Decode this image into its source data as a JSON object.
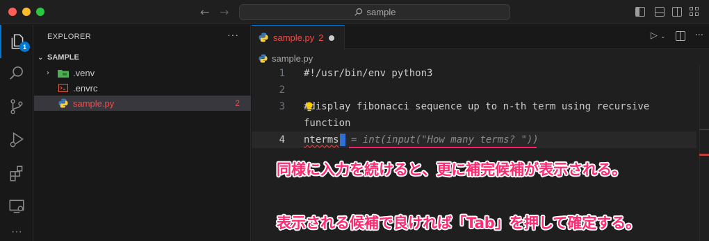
{
  "window": {
    "search_text": "sample"
  },
  "activity_bar": {
    "explorer_badge": "1"
  },
  "sidebar": {
    "title": "EXPLORER",
    "more": "···",
    "section": "SAMPLE",
    "items": [
      {
        "name": ".venv",
        "type": "folder"
      },
      {
        "name": ".envrc",
        "type": "file"
      },
      {
        "name": "sample.py",
        "type": "python",
        "errors": "2"
      }
    ]
  },
  "editor": {
    "tab": {
      "name": "sample.py",
      "count": "2"
    },
    "breadcrumb": "sample.py",
    "lines": [
      {
        "number": "1",
        "text": "#!/usr/bin/env python3"
      },
      {
        "number": "2",
        "text": ""
      },
      {
        "number": "3",
        "text": "#display fibonacci sequence up to n-th term using recursive"
      },
      {
        "number": "",
        "text": "function"
      },
      {
        "number": "4",
        "typed": "nterms",
        "suggestion": "= int(input(\"How many terms? \"))"
      }
    ]
  },
  "annotations": {
    "line1": "同様に入力を続けると、更に補完候補が表示される。",
    "line2": "表示される候補で良ければ「Tab」を押して確定する。"
  },
  "colors": {
    "accent": "#0078d4",
    "error": "#f14c4c",
    "annotation": "#ff2a70"
  }
}
